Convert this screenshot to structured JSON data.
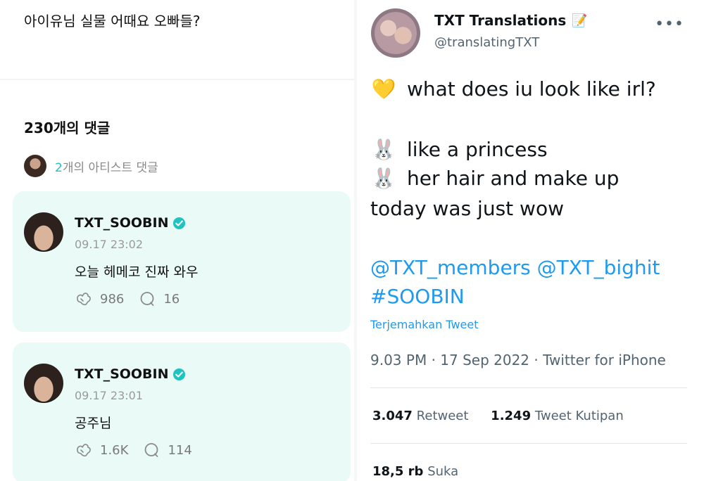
{
  "weverse": {
    "post_text": "아이유님 실물 어때요 오빠들?",
    "comments_count": "230개의 댓글",
    "artist_comments": {
      "number": "2",
      "label": "개의 아티스트 댓글"
    },
    "comments": [
      {
        "author": "TXT_SOOBIN",
        "time": "09.17 23:02",
        "text": "오늘 헤메코 진짜 와우",
        "likes": "986",
        "replies": "16"
      },
      {
        "author": "TXT_SOOBIN",
        "time": "09.17 23:01",
        "text": "공주님",
        "likes": "1.6K",
        "replies": "114"
      }
    ],
    "colors": {
      "card_bg": "#eafaf7",
      "accent": "#1fc4c0",
      "verified": "#1fc4c0"
    }
  },
  "tweet": {
    "display_name": "TXT Translations",
    "name_emoji": "📝",
    "handle": "@translatingTXT",
    "more": "•••",
    "lines": [
      {
        "emoji": "💛",
        "text": "what does iu look like irl?"
      },
      {
        "emoji": "🐰",
        "text": "like a princess"
      },
      {
        "emoji": "🐰",
        "text": "her hair and make up"
      },
      {
        "text": "today was just wow"
      }
    ],
    "mentions": "@TXT_members @TXT_bighit",
    "hashtag": "#SOOBIN",
    "translate": "Terjemahkan Tweet",
    "meta": "9.03 PM · 17 Sep 2022 · Twitter for iPhone",
    "retweets": {
      "count": "3.047",
      "label": "Retweet"
    },
    "quotes": {
      "count": "1.249",
      "label": "Tweet Kutipan"
    },
    "likes": {
      "count": "18,5 rb",
      "label": "Suka"
    },
    "colors": {
      "link": "#1d9bf0",
      "secondary": "#536471"
    }
  }
}
